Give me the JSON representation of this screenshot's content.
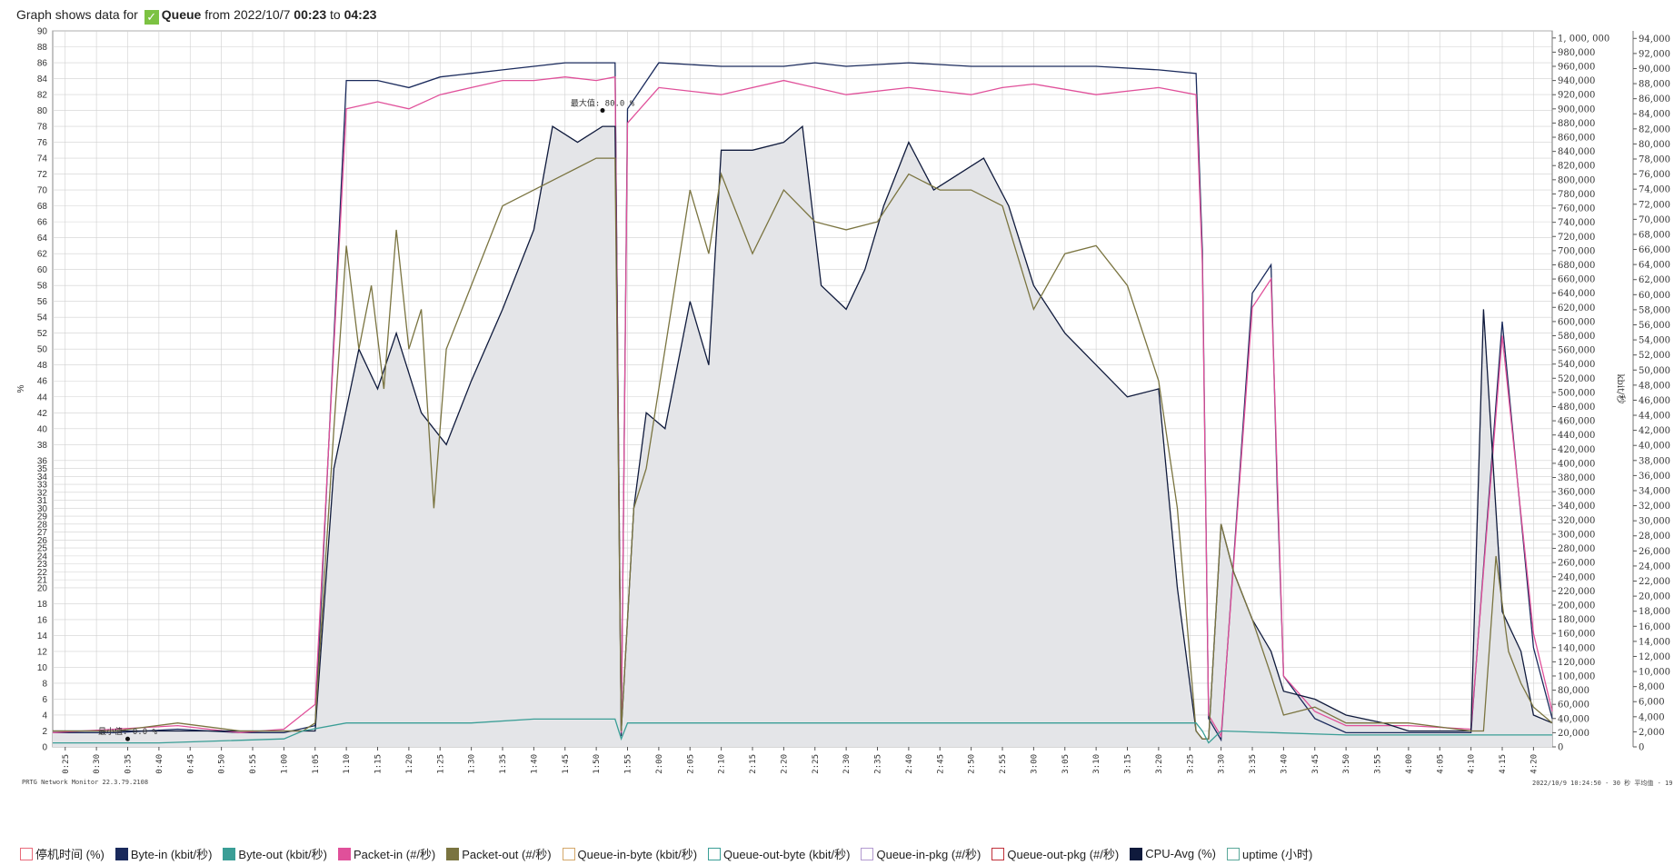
{
  "header": {
    "prefix": "Graph shows data for",
    "sensor": "Queue",
    "from_word": "from",
    "date": "2022/10/7",
    "start": "00:23",
    "to_word": "to",
    "end": "04:23"
  },
  "footer": {
    "left": "PRTG Network Monitor 22.3.79.2108",
    "right": "2022/10/9 10:24:50 - 30 秒 平均值 - 19 :"
  },
  "colors": {
    "byte_in": "#1a2a5c",
    "packet_in": "#e0509a",
    "packet_out": "#7a7440",
    "byte_out": "#3a9e96",
    "area_fill": "#e4e5e8",
    "grid": "#d0d0d0"
  },
  "legend": [
    {
      "label": "停机时间 (%)",
      "color": "#e86a7a",
      "fill": false
    },
    {
      "label": "Byte-in (kbit/秒)",
      "color": "#1a2a5c",
      "fill": true
    },
    {
      "label": "Byte-out (kbit/秒)",
      "color": "#3a9e96",
      "fill": true
    },
    {
      "label": "Packet-in (#/秒)",
      "color": "#e0509a",
      "fill": true
    },
    {
      "label": "Packet-out (#/秒)",
      "color": "#7a7440",
      "fill": true
    },
    {
      "label": "Queue-in-byte (kbit/秒)",
      "color": "#d4a86a",
      "fill": false
    },
    {
      "label": "Queue-out-byte (kbit/秒)",
      "color": "#3a9e96",
      "fill": false
    },
    {
      "label": "Queue-in-pkg (#/秒)",
      "color": "#b39ad0",
      "fill": false
    },
    {
      "label": "Queue-out-pkg (#/秒)",
      "color": "#c0303a",
      "fill": false
    },
    {
      "label": "CPU-Avg (%)",
      "color": "#0f1a3c",
      "fill": true
    },
    {
      "label": "uptime (小时)",
      "color": "#5aa89a",
      "fill": false
    }
  ],
  "chart_data": {
    "type": "line",
    "ylabel": "%",
    "y2label": "kbit/秒",
    "ylim": [
      0,
      90
    ],
    "y2lim": [
      0,
      1010000
    ],
    "y3lim": [
      0,
      95000
    ],
    "left_ticks": [
      "0",
      "2",
      "4",
      "6",
      "8",
      "10",
      "12",
      "14",
      "16",
      "18",
      "20",
      "21",
      "22",
      "23",
      "24",
      "25",
      "26",
      "27",
      "28",
      "29",
      "30",
      "31",
      "32",
      "33",
      "34",
      "35",
      "36",
      "38",
      "40",
      "42",
      "44",
      "46",
      "48",
      "50",
      "52",
      "54",
      "56",
      "58",
      "60",
      "62",
      "64",
      "66",
      "68",
      "70",
      "72",
      "74",
      "76",
      "78",
      "80",
      "82",
      "84",
      "86",
      "88",
      "90"
    ],
    "right_ticks": [
      "0",
      "20,000",
      "40,000",
      "60,000",
      "80,000",
      "100,000",
      "120,000",
      "140,000",
      "160,000",
      "180,000",
      "200,000",
      "220,000",
      "240,000",
      "260,000",
      "280,000",
      "300,000",
      "320,000",
      "340,000",
      "360,000",
      "380,000",
      "400,000",
      "420,000",
      "440,000",
      "460,000",
      "480,000",
      "500,000",
      "520,000",
      "540,000",
      "560,000",
      "580,000",
      "600,000",
      "620,000",
      "640,000",
      "660,000",
      "680,000",
      "700,000",
      "720,000",
      "740,000",
      "760,000",
      "780,000",
      "800,000",
      "820,000",
      "840,000",
      "860,000",
      "880,000",
      "900,000",
      "920,000",
      "940,000",
      "960,000",
      "980,000",
      "1, 000, 000"
    ],
    "far_right_ticks": [
      "0",
      "2,000",
      "4,000",
      "6,000",
      "8,000",
      "10,000",
      "12,000",
      "14,000",
      "16,000",
      "18,000",
      "20,000",
      "22,000",
      "24,000",
      "26,000",
      "28,000",
      "30,000",
      "32,000",
      "34,000",
      "36,000",
      "38,000",
      "40,000",
      "42,000",
      "44,000",
      "46,000",
      "48,000",
      "50,000",
      "52,000",
      "54,000",
      "56,000",
      "58,000",
      "60,000",
      "62,000",
      "64,000",
      "66,000",
      "68,000",
      "70,000",
      "72,000",
      "74,000",
      "76,000",
      "78,000",
      "80,000",
      "82,000",
      "84,000",
      "86,000",
      "88,000",
      "90,000",
      "92,000",
      "94,000"
    ],
    "x_ticks": [
      "0:25",
      "0:30",
      "0:35",
      "0:40",
      "0:45",
      "0:50",
      "0:55",
      "1:00",
      "1:05",
      "1:10",
      "1:15",
      "1:20",
      "1:25",
      "1:30",
      "1:35",
      "1:40",
      "1:45",
      "1:50",
      "1:55",
      "2:00",
      "2:05",
      "2:10",
      "2:15",
      "2:20",
      "2:25",
      "2:30",
      "2:35",
      "2:40",
      "2:45",
      "2:50",
      "2:55",
      "3:00",
      "3:05",
      "3:10",
      "3:15",
      "3:20",
      "3:25",
      "3:30",
      "3:35",
      "3:40",
      "3:45",
      "3:50",
      "3:55",
      "4:00",
      "4:05",
      "4:10",
      "4:15",
      "4:20"
    ],
    "xlim_minutes": [
      23,
      263
    ],
    "annotations": [
      {
        "text": "最大值: 80.0 %",
        "x_minutes": 111,
        "y": 80
      },
      {
        "text": "最小值: 0.0 %",
        "x_minutes": 35,
        "y": 1
      }
    ],
    "series": [
      {
        "key": "byte_in",
        "name": "Byte-in (kbit/秒)",
        "axis": "right",
        "x": [
          23,
          33,
          43,
          53,
          60,
          65,
          70,
          75,
          80,
          85,
          90,
          95,
          100,
          105,
          110,
          113,
          114,
          115,
          120,
          130,
          140,
          145,
          150,
          160,
          170,
          175,
          180,
          190,
          200,
          206,
          207,
          208,
          210,
          215,
          218,
          219,
          220,
          225,
          230,
          240,
          250,
          255,
          260,
          263
        ],
        "y": [
          20000,
          20000,
          25000,
          20000,
          20000,
          30000,
          940000,
          940000,
          930000,
          945000,
          950000,
          955000,
          960000,
          965000,
          965000,
          965000,
          15000,
          900000,
          965000,
          960000,
          960000,
          965000,
          960000,
          965000,
          960000,
          960000,
          960000,
          960000,
          955000,
          950000,
          700000,
          40000,
          10000,
          640000,
          680000,
          360000,
          100000,
          40000,
          20000,
          20000,
          20000,
          600000,
          140000,
          40000
        ]
      },
      {
        "key": "packet_in",
        "name": "Packet-in (#/秒)",
        "axis": "right",
        "x": [
          23,
          33,
          43,
          53,
          60,
          65,
          70,
          75,
          80,
          85,
          90,
          95,
          100,
          105,
          110,
          113,
          114,
          115,
          120,
          130,
          140,
          145,
          150,
          160,
          170,
          175,
          180,
          190,
          200,
          206,
          207,
          208,
          210,
          215,
          218,
          219,
          220,
          225,
          230,
          240,
          250,
          255,
          260,
          263
        ],
        "y": [
          20000,
          25000,
          30000,
          20000,
          25000,
          60000,
          900000,
          910000,
          900000,
          920000,
          930000,
          940000,
          940000,
          945000,
          940000,
          945000,
          20000,
          880000,
          930000,
          920000,
          940000,
          930000,
          920000,
          930000,
          920000,
          930000,
          935000,
          920000,
          930000,
          920000,
          680000,
          45000,
          15000,
          620000,
          660000,
          380000,
          100000,
          50000,
          30000,
          30000,
          25000,
          580000,
          160000,
          50000
        ]
      },
      {
        "key": "cpu_avg",
        "name": "CPU-Avg (%)",
        "axis": "left",
        "x": [
          23,
          33,
          43,
          53,
          60,
          63,
          65,
          68,
          72,
          75,
          78,
          82,
          86,
          90,
          95,
          100,
          103,
          107,
          111,
          113,
          114,
          116,
          118,
          121,
          125,
          128,
          130,
          135,
          140,
          143,
          146,
          150,
          153,
          156,
          160,
          164,
          168,
          172,
          176,
          180,
          185,
          190,
          195,
          200,
          203,
          206,
          207,
          208,
          210,
          212,
          215,
          218,
          220,
          225,
          230,
          236,
          240,
          243,
          245,
          248,
          250,
          252,
          255,
          258,
          260,
          263
        ],
        "y": [
          2,
          2,
          2,
          2,
          2,
          2,
          2,
          35,
          50,
          45,
          52,
          42,
          38,
          46,
          55,
          65,
          78,
          76,
          78,
          78,
          2,
          30,
          42,
          40,
          56,
          48,
          75,
          75,
          76,
          78,
          58,
          55,
          60,
          68,
          76,
          70,
          72,
          74,
          68,
          58,
          52,
          48,
          44,
          45,
          20,
          2,
          1,
          1,
          28,
          22,
          16,
          12,
          7,
          6,
          4,
          3,
          2,
          2,
          2,
          2,
          2,
          55,
          17,
          12,
          4,
          3
        ]
      },
      {
        "key": "packet_out",
        "name": "Packet-out (#/秒)",
        "axis": "left",
        "x": [
          23,
          33,
          43,
          53,
          60,
          63,
          65,
          68,
          70,
          72,
          74,
          76,
          78,
          80,
          82,
          84,
          86,
          90,
          95,
          100,
          105,
          110,
          113,
          114,
          116,
          118,
          121,
          125,
          128,
          130,
          135,
          140,
          145,
          150,
          155,
          160,
          165,
          170,
          175,
          180,
          185,
          190,
          195,
          200,
          203,
          206,
          207,
          208,
          210,
          212,
          215,
          218,
          220,
          225,
          230,
          240,
          250,
          252,
          254,
          256,
          258,
          260,
          263
        ],
        "y": [
          2,
          2,
          3,
          2,
          2,
          2,
          3,
          40,
          63,
          50,
          58,
          45,
          65,
          50,
          55,
          30,
          50,
          58,
          68,
          70,
          72,
          74,
          74,
          2,
          30,
          35,
          50,
          70,
          62,
          72,
          62,
          70,
          66,
          65,
          66,
          72,
          70,
          70,
          68,
          55,
          62,
          63,
          58,
          46,
          30,
          2,
          1,
          1,
          28,
          22,
          16,
          9,
          4,
          5,
          3,
          3,
          2,
          2,
          24,
          12,
          8,
          5,
          3
        ]
      },
      {
        "key": "byte_out",
        "name": "Byte-out (kbit/秒)",
        "axis": "left",
        "x": [
          23,
          40,
          60,
          63,
          70,
          80,
          90,
          100,
          113,
          114,
          115,
          130,
          150,
          170,
          190,
          206,
          207,
          208,
          210,
          230,
          250,
          263
        ],
        "y": [
          0.5,
          0.5,
          1,
          2,
          3,
          3,
          3,
          3.5,
          3.5,
          1,
          3,
          3,
          3,
          3,
          3,
          3,
          2,
          0.5,
          2,
          1.5,
          1.5,
          1.5
        ]
      }
    ]
  }
}
